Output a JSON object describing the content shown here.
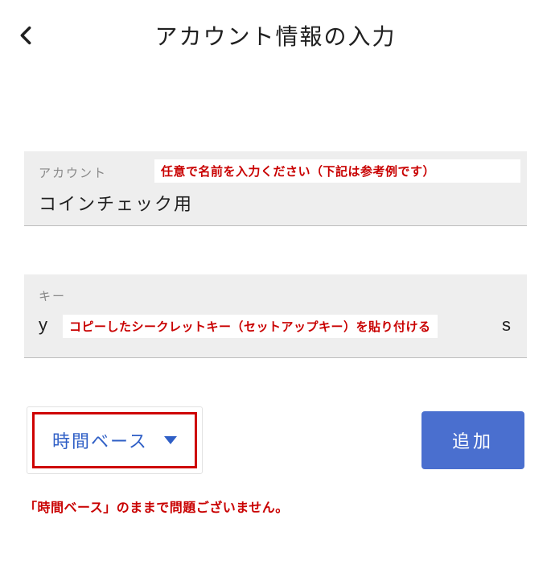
{
  "header": {
    "title": "アカウント情報の入力"
  },
  "fields": {
    "account": {
      "label": "アカウント",
      "value": "コインチェック用",
      "annotation": "任意で名前を入力ください（下記は参考例です）"
    },
    "key": {
      "label": "キー",
      "value_left": "y",
      "value_right": "s",
      "annotation": "コピーしたシークレットキー（セットアップキー）を貼り付ける"
    }
  },
  "dropdown": {
    "selected": "時間ベース"
  },
  "submit": {
    "label": "追加"
  },
  "note": "「時間ベース」のままで問題ございません。"
}
